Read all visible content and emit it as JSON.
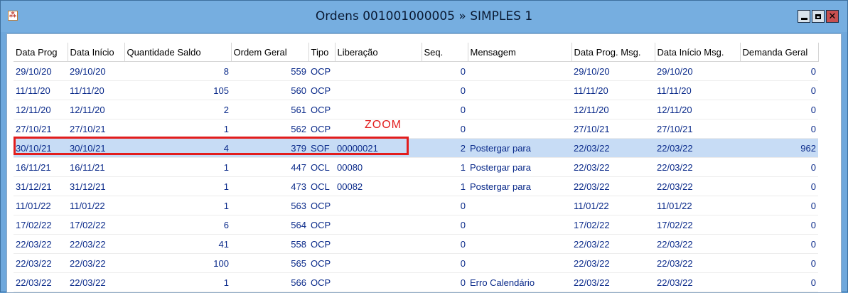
{
  "window": {
    "title": "Ordens 001001000005 » SIMPLES 1"
  },
  "annotation": {
    "label": "ZOOM"
  },
  "table": {
    "columns": [
      "Data Prog",
      "Data Início",
      "Quantidade Saldo",
      "Ordem Geral",
      "Tipo",
      "Liberação",
      "Seq.",
      "Mensagem",
      "Data Prog. Msg.",
      "Data Início Msg.",
      "Demanda Geral"
    ],
    "rows": [
      [
        "29/10/20",
        "29/10/20",
        "8",
        "559",
        "OCP",
        "",
        "0",
        "",
        "29/10/20",
        "29/10/20",
        "0"
      ],
      [
        "11/11/20",
        "11/11/20",
        "105",
        "560",
        "OCP",
        "",
        "0",
        "",
        "11/11/20",
        "11/11/20",
        "0"
      ],
      [
        "12/11/20",
        "12/11/20",
        "2",
        "561",
        "OCP",
        "",
        "0",
        "",
        "12/11/20",
        "12/11/20",
        "0"
      ],
      [
        "27/10/21",
        "27/10/21",
        "1",
        "562",
        "OCP",
        "",
        "0",
        "",
        "27/10/21",
        "27/10/21",
        "0"
      ],
      [
        "30/10/21",
        "30/10/21",
        "4",
        "379",
        "SOF",
        "00000021",
        "2",
        "Postergar para",
        "22/03/22",
        "22/03/22",
        "962"
      ],
      [
        "16/11/21",
        "16/11/21",
        "1",
        "447",
        "OCL",
        "00080",
        "1",
        "Postergar para",
        "22/03/22",
        "22/03/22",
        "0"
      ],
      [
        "31/12/21",
        "31/12/21",
        "1",
        "473",
        "OCL",
        "00082",
        "1",
        "Postergar para",
        "22/03/22",
        "22/03/22",
        "0"
      ],
      [
        "11/01/22",
        "11/01/22",
        "1",
        "563",
        "OCP",
        "",
        "0",
        "",
        "11/01/22",
        "11/01/22",
        "0"
      ],
      [
        "17/02/22",
        "17/02/22",
        "6",
        "564",
        "OCP",
        "",
        "0",
        "",
        "17/02/22",
        "17/02/22",
        "0"
      ],
      [
        "22/03/22",
        "22/03/22",
        "41",
        "558",
        "OCP",
        "",
        "0",
        "",
        "22/03/22",
        "22/03/22",
        "0"
      ],
      [
        "22/03/22",
        "22/03/22",
        "100",
        "565",
        "OCP",
        "",
        "0",
        "",
        "22/03/22",
        "22/03/22",
        "0"
      ],
      [
        "22/03/22",
        "22/03/22",
        "1",
        "566",
        "OCP",
        "",
        "0",
        "Erro Calendário",
        "22/03/22",
        "22/03/22",
        "0"
      ]
    ],
    "selected_row": 4
  }
}
